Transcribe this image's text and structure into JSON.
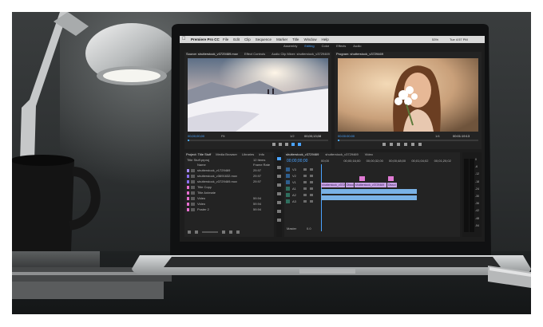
{
  "menubar": {
    "app_name": "Premiere Pro CC",
    "items": [
      "File",
      "Edit",
      "Clip",
      "Sequence",
      "Marker",
      "Title",
      "Window",
      "Help"
    ],
    "battery": "53%",
    "clock": "Tue 4:57 PM"
  },
  "workspace_tabs": [
    "Assembly",
    "Editing",
    "Color",
    "Effects",
    "Audio"
  ],
  "source_panel": {
    "tabs": [
      "Source: shutterstock_v3729469.mov",
      "Effect Controls",
      "Audio Clip Mixer: shutterstock_v3729469"
    ],
    "timecode_in": "00;00;00;00",
    "fit": "Fit",
    "ratio": "1/2",
    "timecode_out": "00;00;13;08"
  },
  "program_panel": {
    "tabs": [
      "Program: shutterstock_v3729469"
    ],
    "timecode_in": "00:00:00:00",
    "ratio": "1/4",
    "timecode_out": "00:01:19:13"
  },
  "project_panel": {
    "tabs": [
      "Project: Title Stuff",
      "Media Browser",
      "Libraries",
      "Info"
    ],
    "project_file": "Title Stuff.prproj",
    "item_count": "12 Items",
    "column_name": "Name",
    "column_rate": "Frame Rate",
    "items": [
      {
        "name": "shutterstock_v1729469",
        "rate": "29.97",
        "color": "#a78bfa"
      },
      {
        "name": "shutterstock_v3691632.mov",
        "rate": "29.97",
        "color": "#8b6ff0"
      },
      {
        "name": "shutterstock_v3729469.mov",
        "rate": "29.97",
        "color": "#8b6ff0"
      },
      {
        "name": "Title Copy",
        "rate": "",
        "color": "#e76fd1"
      },
      {
        "name": "Title Animate",
        "rate": "",
        "color": "#e76fd1"
      },
      {
        "name": "Video",
        "rate": "59.94",
        "color": "#e76fd1"
      },
      {
        "name": "Video",
        "rate": "59.94",
        "color": "#e76fd1"
      },
      {
        "name": "Poster 2",
        "rate": "59.94",
        "color": "#e76fd1"
      }
    ]
  },
  "timeline": {
    "tabs": [
      "shutterstock_v3729469",
      "shutterstock_v3729469",
      "Video"
    ],
    "timecode": "00;00;00;00",
    "ruler": [
      "00;00",
      "00;00;16;00",
      "00;00;32;00",
      "00;00;48;00",
      "00;01;04;02",
      "00;01;20;02"
    ],
    "video_tracks": [
      "V3",
      "V2",
      "V1"
    ],
    "audio_tracks": [
      "A1",
      "A2",
      "A3"
    ],
    "master_label": "Master",
    "master_value": "0.0",
    "clips_v1": [
      "shutterstock_v3729469",
      "Dissol",
      "shutterstock_v3729469",
      "Dissol"
    ],
    "clip_color_v1": "#c9a4e6",
    "clip_color_v2": "#e07ad4",
    "audio_clip_color": "#7ab2e6"
  },
  "meter_scale": [
    "0",
    "-6",
    "-12",
    "-18",
    "-24",
    "-30",
    "-36",
    "-42",
    "-48",
    "-54"
  ]
}
